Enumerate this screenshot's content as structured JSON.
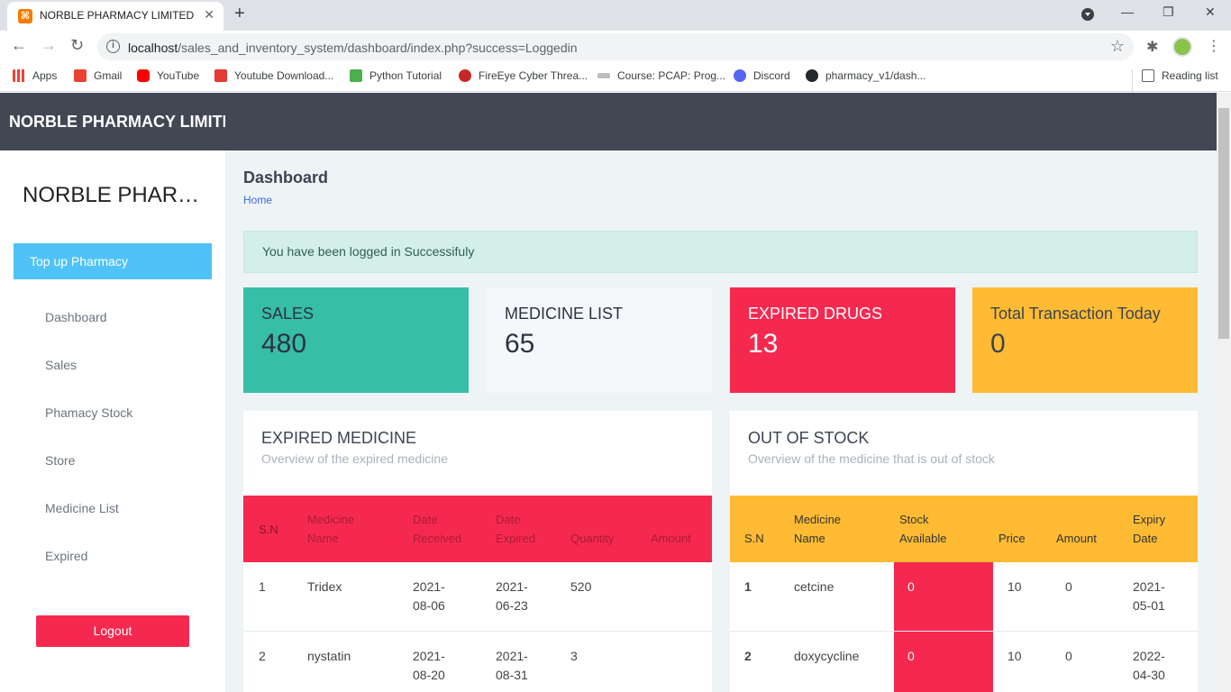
{
  "browser": {
    "tab_title": "NORBLE PHARMACY LIMITED",
    "url_host": "localhost",
    "url_path": "/sales_and_inventory_system/dashboard/index.php?success=Loggedin",
    "bookmarks": [
      {
        "label": "Apps",
        "icon": "apps-grid-icon",
        "color": "#ea4335"
      },
      {
        "label": "Gmail",
        "icon": "gmail-icon",
        "color": "#ea4335"
      },
      {
        "label": "YouTube",
        "icon": "youtube-icon",
        "color": "#ff0000"
      },
      {
        "label": "Youtube Download...",
        "icon": "download-icon",
        "color": "#e53935"
      },
      {
        "label": "Python Tutorial",
        "icon": "w3schools-icon",
        "color": "#4caf50"
      },
      {
        "label": "FireEye Cyber Threa...",
        "icon": "fireeye-icon",
        "color": "#c62828"
      },
      {
        "label": "Course: PCAP: Prog...",
        "icon": "cisco-icon",
        "color": "#9e9e9e"
      },
      {
        "label": "Discord",
        "icon": "discord-icon",
        "color": "#5865f2"
      },
      {
        "label": "pharmacy_v1/dash...",
        "icon": "github-icon",
        "color": "#24292e"
      }
    ],
    "reading_list": "Reading list"
  },
  "header": {
    "brand": "NORBLE PHARMACY LIMITED"
  },
  "sidebar": {
    "title": "NORBLE PHARMACY LIMITED",
    "topup": "Top up Pharmacy",
    "items": [
      "Dashboard",
      "Sales",
      "Phamacy Stock",
      "Store",
      "Medicine List",
      "Expired"
    ],
    "logout": "Logout"
  },
  "main": {
    "title": "Dashboard",
    "breadcrumb": "Home",
    "alert": "You have been logged in Successifuly",
    "stats": [
      {
        "label": "SALES",
        "value": "480"
      },
      {
        "label": "MEDICINE LIST",
        "value": "65"
      },
      {
        "label": "EXPIRED DRUGS",
        "value": "13"
      },
      {
        "label": "Total Transaction Today",
        "value": "0"
      }
    ],
    "expired": {
      "title": "EXPIRED MEDICINE",
      "subtitle": "Overview of the expired medicine",
      "headers": [
        "S.N",
        "Medicine Name",
        "Date Received",
        "Date Expired",
        "Quantity",
        "Amount"
      ],
      "rows": [
        [
          "1",
          "Tridex",
          "2021-08-06",
          "2021-06-23",
          "520",
          ""
        ],
        [
          "2",
          "nystatin",
          "2021-08-20",
          "2021-08-31",
          "3",
          ""
        ]
      ]
    },
    "out_of_stock": {
      "title": "OUT OF STOCK",
      "subtitle": "Overview of the medicine that is out of stock",
      "headers": [
        "S.N",
        "Medicine Name",
        "Stock Available",
        "Price",
        "Amount",
        "Expiry Date"
      ],
      "rows": [
        [
          "1",
          "cetcine",
          "0",
          "10",
          "0",
          "2021-05-01"
        ],
        [
          "2",
          "doxycycline",
          "0",
          "10",
          "0",
          "2022-04-30"
        ]
      ]
    }
  }
}
